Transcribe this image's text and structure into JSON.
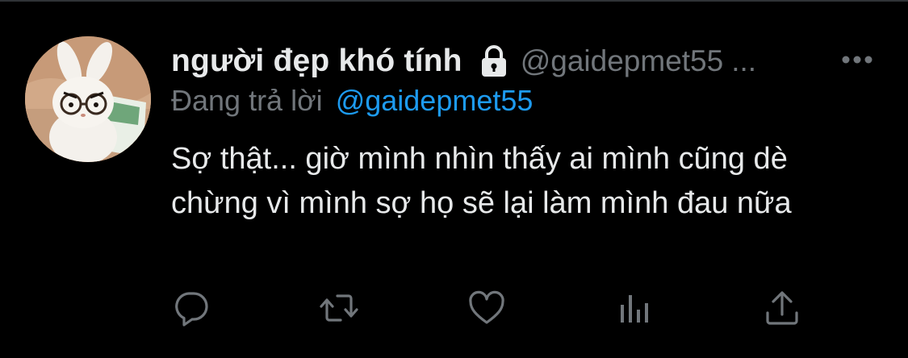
{
  "tweet": {
    "display_name": "người đẹp khó tính",
    "handle": "@gaidepmet55",
    "truncation": "...",
    "reply_prefix": "Đang trả lời",
    "reply_to": "@gaidepmet55",
    "text": "Sợ thật... giờ mình nhìn thấy ai mình cũng dè chừng vì mình sợ họ sẽ lại làm mình đau nữa"
  },
  "icons": {
    "lock": "lock-icon",
    "more": "more-icon",
    "reply": "reply-icon",
    "retweet": "retweet-icon",
    "like": "heart-icon",
    "views": "bar-chart-icon",
    "share": "share-icon"
  },
  "colors": {
    "background": "#000000",
    "primary_text": "#e7e9ea",
    "secondary_text": "#71767b",
    "link": "#1d9bf0"
  }
}
